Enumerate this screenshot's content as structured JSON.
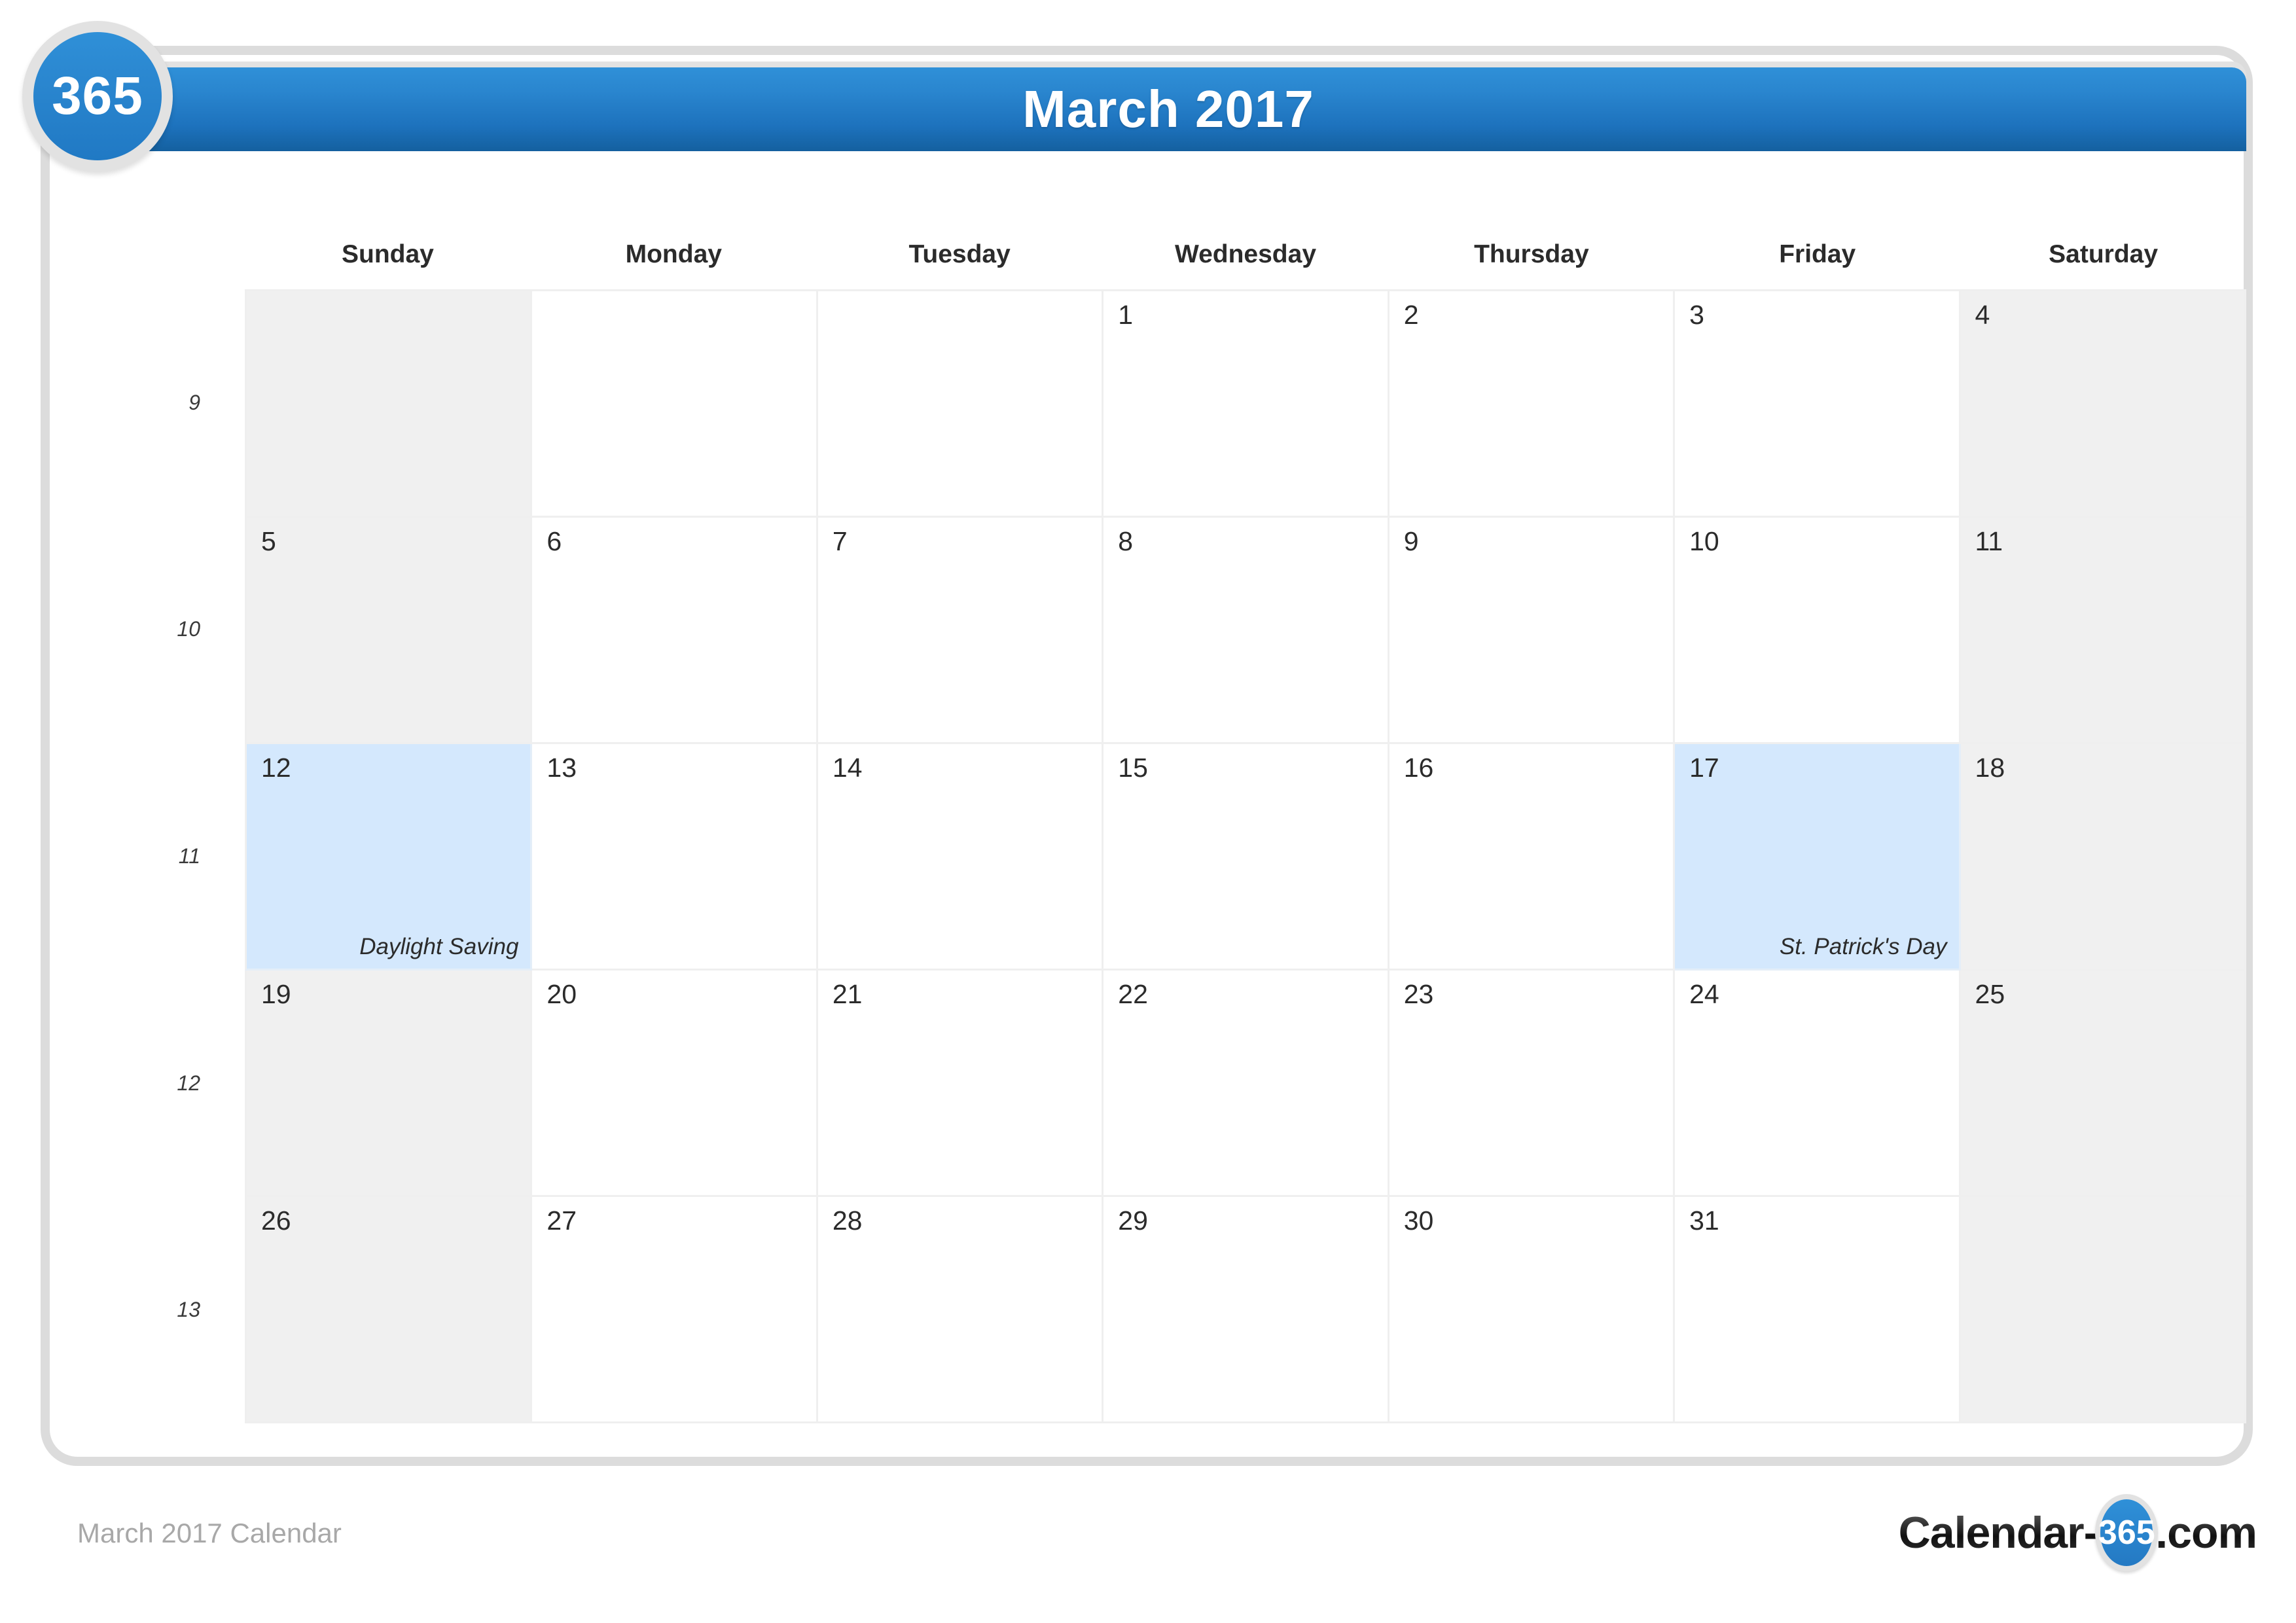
{
  "brand": {
    "badge_text": "365",
    "watermark_text": "365"
  },
  "header": {
    "title": "March 2017"
  },
  "calendar": {
    "day_headers": [
      "Sunday",
      "Monday",
      "Tuesday",
      "Wednesday",
      "Thursday",
      "Friday",
      "Saturday"
    ],
    "week_numbers": [
      "9",
      "10",
      "11",
      "12",
      "13"
    ],
    "weeks": [
      {
        "week_number": "9",
        "days": [
          {
            "num": "",
            "event": "",
            "weekend": true,
            "blank": true
          },
          {
            "num": "",
            "event": "",
            "weekend": false,
            "blank": true
          },
          {
            "num": "",
            "event": "",
            "weekend": false,
            "blank": true
          },
          {
            "num": "1",
            "event": "",
            "weekend": false,
            "blank": false
          },
          {
            "num": "2",
            "event": "",
            "weekend": false,
            "blank": false
          },
          {
            "num": "3",
            "event": "",
            "weekend": false,
            "blank": false
          },
          {
            "num": "4",
            "event": "",
            "weekend": true,
            "blank": false
          }
        ]
      },
      {
        "week_number": "10",
        "days": [
          {
            "num": "5",
            "event": "",
            "weekend": true,
            "blank": false
          },
          {
            "num": "6",
            "event": "",
            "weekend": false,
            "blank": false
          },
          {
            "num": "7",
            "event": "",
            "weekend": false,
            "blank": false
          },
          {
            "num": "8",
            "event": "",
            "weekend": false,
            "blank": false
          },
          {
            "num": "9",
            "event": "",
            "weekend": false,
            "blank": false
          },
          {
            "num": "10",
            "event": "",
            "weekend": false,
            "blank": false
          },
          {
            "num": "11",
            "event": "",
            "weekend": true,
            "blank": false
          }
        ]
      },
      {
        "week_number": "11",
        "days": [
          {
            "num": "12",
            "event": "Daylight Saving",
            "weekend": true,
            "blank": false
          },
          {
            "num": "13",
            "event": "",
            "weekend": false,
            "blank": false
          },
          {
            "num": "14",
            "event": "",
            "weekend": false,
            "blank": false
          },
          {
            "num": "15",
            "event": "",
            "weekend": false,
            "blank": false
          },
          {
            "num": "16",
            "event": "",
            "weekend": false,
            "blank": false
          },
          {
            "num": "17",
            "event": "St. Patrick's Day",
            "weekend": false,
            "blank": false
          },
          {
            "num": "18",
            "event": "",
            "weekend": true,
            "blank": false
          }
        ]
      },
      {
        "week_number": "12",
        "days": [
          {
            "num": "19",
            "event": "",
            "weekend": true,
            "blank": false
          },
          {
            "num": "20",
            "event": "",
            "weekend": false,
            "blank": false
          },
          {
            "num": "21",
            "event": "",
            "weekend": false,
            "blank": false
          },
          {
            "num": "22",
            "event": "",
            "weekend": false,
            "blank": false
          },
          {
            "num": "23",
            "event": "",
            "weekend": false,
            "blank": false
          },
          {
            "num": "24",
            "event": "",
            "weekend": false,
            "blank": false
          },
          {
            "num": "25",
            "event": "",
            "weekend": true,
            "blank": false
          }
        ]
      },
      {
        "week_number": "13",
        "days": [
          {
            "num": "26",
            "event": "",
            "weekend": true,
            "blank": false
          },
          {
            "num": "27",
            "event": "",
            "weekend": false,
            "blank": false
          },
          {
            "num": "28",
            "event": "",
            "weekend": false,
            "blank": false
          },
          {
            "num": "29",
            "event": "",
            "weekend": false,
            "blank": false
          },
          {
            "num": "30",
            "event": "",
            "weekend": false,
            "blank": false
          },
          {
            "num": "31",
            "event": "",
            "weekend": false,
            "blank": false
          },
          {
            "num": "",
            "event": "",
            "weekend": true,
            "blank": true
          }
        ]
      }
    ]
  },
  "footer": {
    "caption": "March 2017 Calendar",
    "logo_prefix": "Calendar-",
    "logo_circle": "365",
    "logo_suffix": ".com"
  },
  "colors": {
    "header_top": "#2f90d8",
    "header_bottom": "#14609f",
    "event_highlight": "#d4e8fd",
    "weekend_bg": "#f0f0f0",
    "grid_line": "#efefef",
    "frame_border": "#dcdcdc",
    "footer_text": "#a8a8a8"
  }
}
